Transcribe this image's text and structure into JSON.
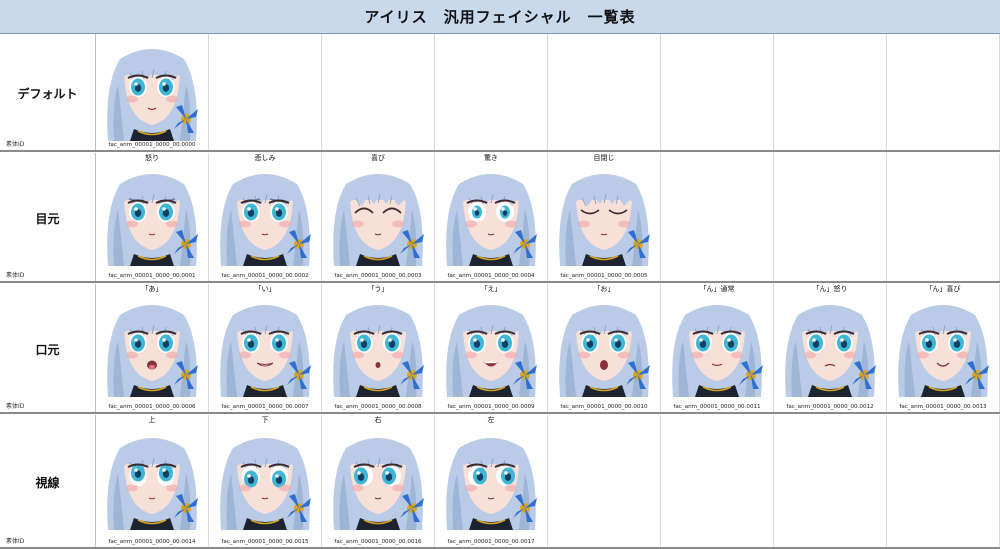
{
  "sheet": {
    "title": "アイリス　汎用フェイシャル　一覧表",
    "id_caption": "素体ID"
  },
  "rows": [
    {
      "category": "デフォルト",
      "cells": [
        {
          "name": "",
          "file": "fac_anm_00001_0000_00.0000",
          "eyes": "open",
          "mouth": "smile"
        }
      ]
    },
    {
      "category": "目元",
      "cells": [
        {
          "name": "怒り",
          "file": "fac_anm_00001_0000_00.0001",
          "eyes": "angry",
          "mouth": "small"
        },
        {
          "name": "悲しみ",
          "file": "fac_anm_00001_0000_00.0002",
          "eyes": "sad",
          "mouth": "small"
        },
        {
          "name": "喜び",
          "file": "fac_anm_00001_0000_00.0003",
          "eyes": "happy",
          "mouth": "small"
        },
        {
          "name": "驚き",
          "file": "fac_anm_00001_0000_00.0004",
          "eyes": "surprised",
          "mouth": "small"
        },
        {
          "name": "目閉じ",
          "file": "fac_anm_00001_0000_00.0005",
          "eyes": "closed",
          "mouth": "small"
        }
      ]
    },
    {
      "category": "口元",
      "cells": [
        {
          "name": "「あ」",
          "file": "fac_anm_00001_0000_00.0006",
          "eyes": "open",
          "mouth": "a"
        },
        {
          "name": "「い」",
          "file": "fac_anm_00001_0000_00.0007",
          "eyes": "open",
          "mouth": "i"
        },
        {
          "name": "「う」",
          "file": "fac_anm_00001_0000_00.0008",
          "eyes": "open",
          "mouth": "u"
        },
        {
          "name": "「え」",
          "file": "fac_anm_00001_0000_00.0009",
          "eyes": "open",
          "mouth": "e"
        },
        {
          "name": "「お」",
          "file": "fac_anm_00001_0000_00.0010",
          "eyes": "open",
          "mouth": "o"
        },
        {
          "name": "「ん」通常",
          "file": "fac_anm_00001_0000_00.0011",
          "eyes": "open",
          "mouth": "n"
        },
        {
          "name": "「ん」怒り",
          "file": "fac_anm_00001_0000_00.0012",
          "eyes": "open",
          "mouth": "n-angry"
        },
        {
          "name": "「ん」喜び",
          "file": "fac_anm_00001_0000_00.0013",
          "eyes": "open",
          "mouth": "n-happy"
        }
      ]
    },
    {
      "category": "視線",
      "cells": [
        {
          "name": "上",
          "file": "fac_anm_00001_0000_00.0014",
          "eyes": "look-up",
          "mouth": "small"
        },
        {
          "name": "下",
          "file": "fac_anm_00001_0000_00.0015",
          "eyes": "look-down",
          "mouth": "small"
        },
        {
          "name": "右",
          "file": "fac_anm_00001_0000_00.0016",
          "eyes": "look-right",
          "mouth": "small"
        },
        {
          "name": "左",
          "file": "fac_anm_00001_0000_00.0017",
          "eyes": "look-left",
          "mouth": "small"
        }
      ]
    }
  ],
  "colors": {
    "header_bg": "#c9d9ec",
    "hair": "#b9cbe6",
    "hair_shadow": "#8ea6cc",
    "skin": "#f7e0d8",
    "blush": "#f2a3a8",
    "iris": "#3fb6d6",
    "ribbon": "#2f6fd0",
    "collar": "#1d2430",
    "gold": "#d9a520"
  }
}
